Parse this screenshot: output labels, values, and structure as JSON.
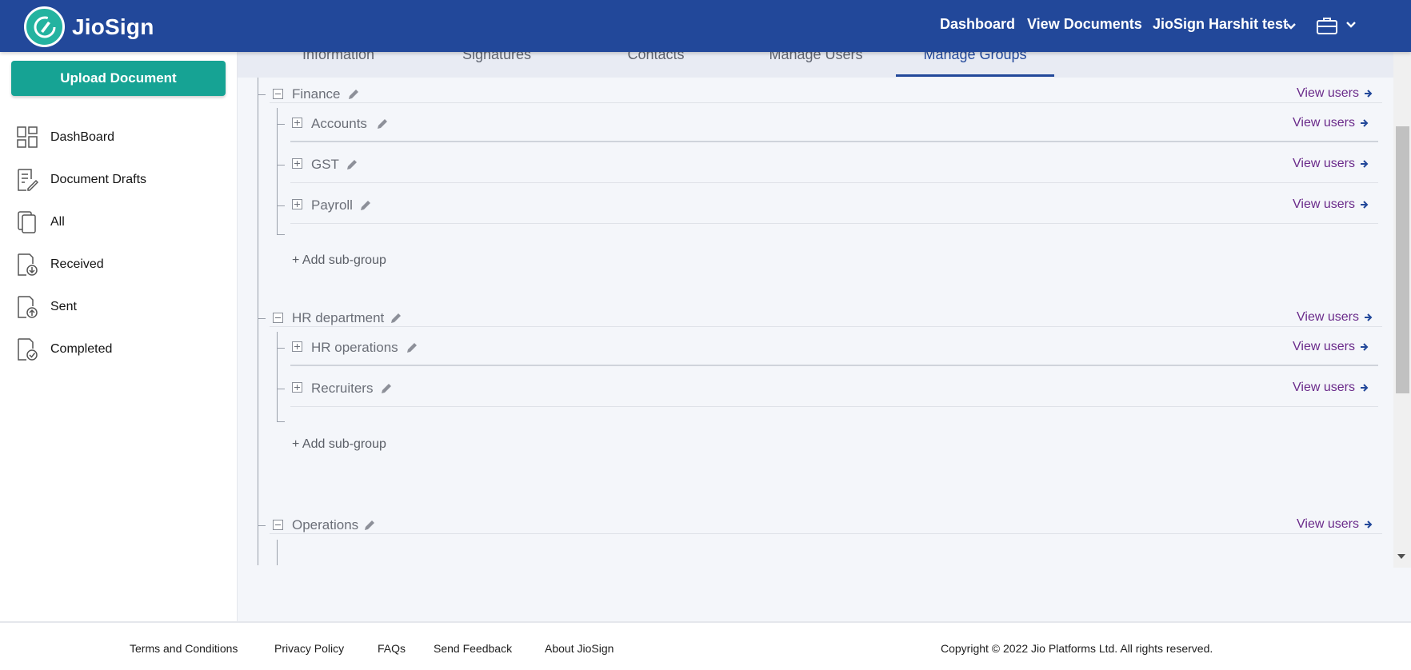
{
  "header": {
    "logo_text": "JioSign",
    "nav": {
      "dashboard": "Dashboard",
      "view_documents": "View Documents",
      "account": "JioSign Harshit test"
    }
  },
  "sidebar": {
    "upload_label": "Upload Document",
    "items": [
      {
        "label": "DashBoard",
        "icon": "dashboard-icon"
      },
      {
        "label": "Document Drafts",
        "icon": "document-drafts-icon"
      },
      {
        "label": "All",
        "icon": "all-documents-icon"
      },
      {
        "label": "Received",
        "icon": "received-icon"
      },
      {
        "label": "Sent",
        "icon": "sent-icon"
      },
      {
        "label": "Completed",
        "icon": "completed-icon"
      }
    ]
  },
  "tabs": {
    "items": [
      "Information",
      "Signatures",
      "Contacts",
      "Manage Users",
      "Manage Groups"
    ],
    "active": "Manage Groups"
  },
  "groups": {
    "view_users_label": "View users",
    "add_subgroup_label": "+ Add sub-group",
    "items": [
      {
        "name": "Finance",
        "subgroups": [
          "Accounts",
          "GST",
          "Payroll"
        ]
      },
      {
        "name": "HR department",
        "subgroups": [
          "HR operations",
          "Recruiters"
        ]
      },
      {
        "name": "Operations",
        "subgroups": []
      }
    ]
  },
  "footer": {
    "links": [
      "Terms and Conditions",
      "Privacy Policy",
      "FAQs",
      "Send Feedback",
      "About JioSign"
    ],
    "copyright": "Copyright © 2022 Jio Platforms Ltd. All rights reserved."
  },
  "colors": {
    "header_bg": "#22489a",
    "upload_button": "#16a394",
    "view_users_text": "#6a2a8a"
  }
}
